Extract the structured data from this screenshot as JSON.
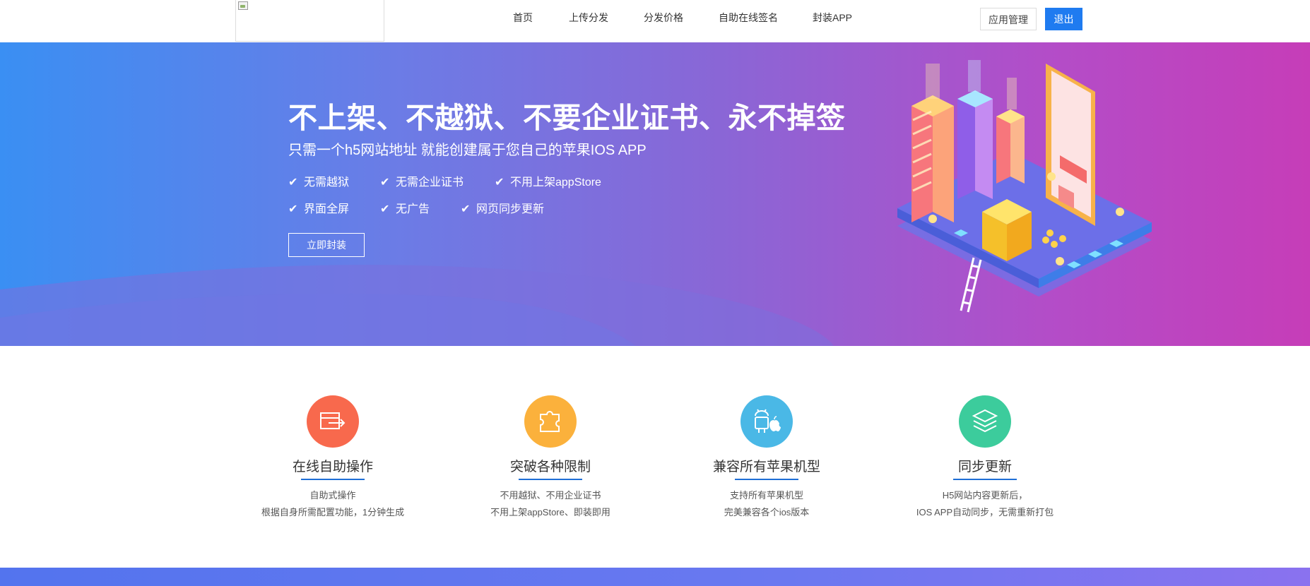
{
  "header": {
    "nav": [
      "首页",
      "上传分发",
      "分发价格",
      "自助在线签名",
      "封装APP"
    ],
    "manage_label": "应用管理",
    "logout_label": "退出"
  },
  "hero": {
    "title": "不上架、不越狱、不要企业证书、永不掉签",
    "subtitle": "只需一个h5网站地址 就能创建属于您自己的苹果IOS APP",
    "features": [
      "无需越狱",
      "无需企业证书",
      "不用上架appStore",
      "界面全屏",
      "无广告",
      "网页同步更新"
    ],
    "button": "立即封装"
  },
  "features": [
    {
      "title": "在线自助操作",
      "desc1": "自助式操作",
      "desc2": "根据自身所需配置功能，1分钟生成",
      "icon": "export-icon",
      "color": "#f8694d"
    },
    {
      "title": "突破各种限制",
      "desc1": "不用越狱、不用企业证书",
      "desc2": "不用上架appStore、即装即用",
      "icon": "puzzle-icon",
      "color": "#fbb13c"
    },
    {
      "title": "兼容所有苹果机型",
      "desc1": "支持所有苹果机型",
      "desc2": "完美兼容各个ios版本",
      "icon": "android-apple-icon",
      "color": "#4ab8e6"
    },
    {
      "title": "同步更新",
      "desc1": "H5网站内容更新后，",
      "desc2": "IOS APP自动同步，无需重新打包",
      "icon": "layers-icon",
      "color": "#3ccc9c"
    }
  ],
  "colors": {
    "primary": "#1f7bf0",
    "hero_start": "#3a8ff3",
    "hero_end": "#c63db8"
  }
}
